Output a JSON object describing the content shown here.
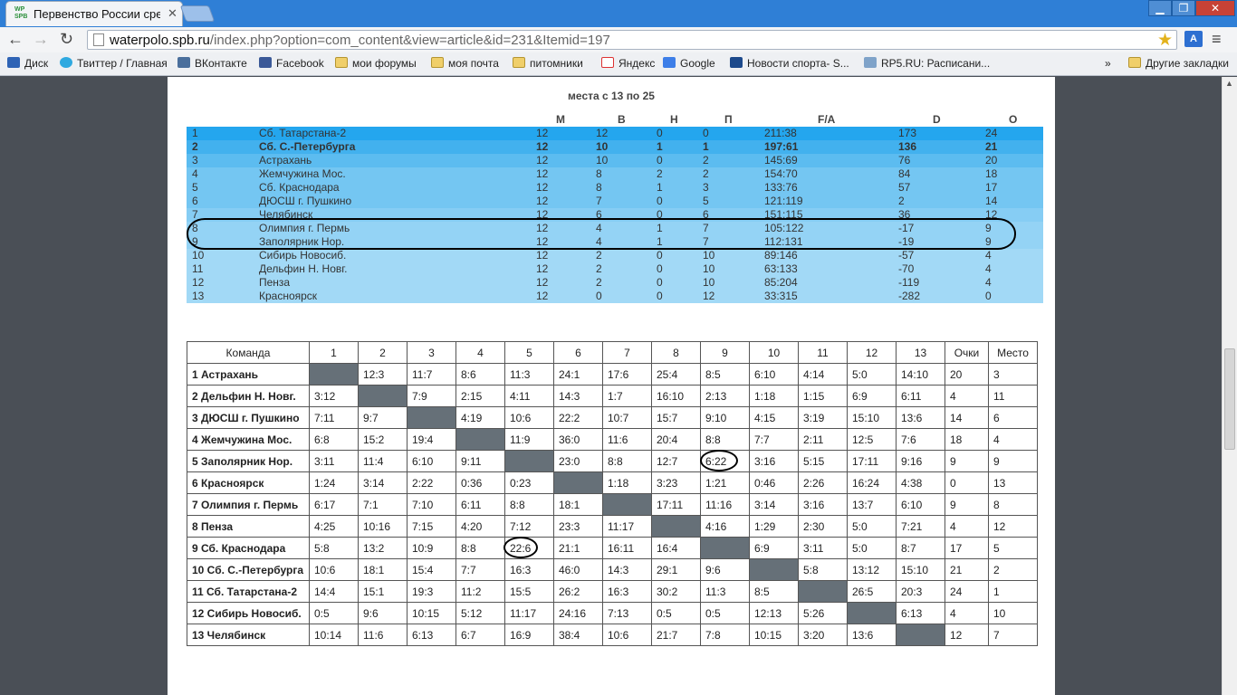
{
  "browser": {
    "tab_title": "Первенство России сред",
    "tab_favicon_text": "WP SPB",
    "url_domain": "waterpolo.spb.ru",
    "url_path": "/index.php?option=com_content&view=article&id=231&Itemid=197",
    "ext_label": "A",
    "bookmarks": [
      {
        "label": "Диск",
        "icon": "disk-icon"
      },
      {
        "label": "Твиттер / Главная",
        "icon": "twitter-icon"
      },
      {
        "label": "ВКонтакте",
        "icon": "vk-icon"
      },
      {
        "label": "Facebook",
        "icon": "facebook-icon"
      },
      {
        "label": "мои форумы",
        "icon": "folder-icon"
      },
      {
        "label": "моя почта",
        "icon": "folder-icon"
      },
      {
        "label": "питомники",
        "icon": "folder-icon"
      },
      {
        "label": "Яндекс",
        "icon": "yandex-icon"
      },
      {
        "label": "Google",
        "icon": "google-icon"
      },
      {
        "label": "Новости спорта- S...",
        "icon": "sport-news-icon"
      },
      {
        "label": "RP5.RU: Расписани...",
        "icon": "rp5-icon"
      }
    ],
    "bookmarks_overflow": "»",
    "other_bookmarks": "Другие закладки"
  },
  "standings_1": {
    "title": "места с 13 по 25",
    "headers": [
      "М",
      "В",
      "Н",
      "П",
      "F/A",
      "D",
      "О"
    ],
    "rows": [
      [
        "1",
        "Сб. Татарстана-2",
        "12",
        "12",
        "0",
        "0",
        "211:38",
        "173",
        "24"
      ],
      [
        "2",
        "Сб. С.-Петербурга",
        "12",
        "10",
        "1",
        "1",
        "197:61",
        "136",
        "21"
      ],
      [
        "3",
        "Астрахань",
        "12",
        "10",
        "0",
        "2",
        "145:69",
        "76",
        "20"
      ],
      [
        "4",
        "Жемчужина Мос.",
        "12",
        "8",
        "2",
        "2",
        "154:70",
        "84",
        "18"
      ],
      [
        "5",
        "Сб. Краснодара",
        "12",
        "8",
        "1",
        "3",
        "133:76",
        "57",
        "17"
      ],
      [
        "6",
        "ДЮСШ г. Пушкино",
        "12",
        "7",
        "0",
        "5",
        "121:119",
        "2",
        "14"
      ],
      [
        "7",
        "Челябинск",
        "12",
        "6",
        "0",
        "6",
        "151:115",
        "36",
        "12"
      ],
      [
        "8",
        "Олимпия г. Пермь",
        "12",
        "4",
        "1",
        "7",
        "105:122",
        "-17",
        "9"
      ],
      [
        "9",
        "Заполярник Нор.",
        "12",
        "4",
        "1",
        "7",
        "112:131",
        "-19",
        "9"
      ],
      [
        "10",
        "Сибирь Новосиб.",
        "12",
        "2",
        "0",
        "10",
        "89:146",
        "-57",
        "4"
      ],
      [
        "11",
        "Дельфин Н. Новг.",
        "12",
        "2",
        "0",
        "10",
        "63:133",
        "-70",
        "4"
      ],
      [
        "12",
        "Пенза",
        "12",
        "2",
        "0",
        "10",
        "85:204",
        "-119",
        "4"
      ],
      [
        "13",
        "Красноярск",
        "12",
        "0",
        "0",
        "12",
        "33:315",
        "-282",
        "0"
      ]
    ],
    "row_colors": [
      "#24a6ee",
      "#42b1ee",
      "#5cbcf0",
      "#74c6f2",
      "#74c6f2",
      "#74c6f2",
      "#86cdf4",
      "#94d3f5",
      "#94d3f5",
      "#a2d9f6",
      "#a2d9f6",
      "#a2d9f6",
      "#a2d9f6"
    ]
  },
  "crosstable": {
    "headers": [
      "Команда",
      "1",
      "2",
      "3",
      "4",
      "5",
      "6",
      "7",
      "8",
      "9",
      "10",
      "11",
      "12",
      "13",
      "Очки",
      "Место"
    ],
    "rows": [
      [
        "1 Астрахань",
        "",
        "12:3",
        "11:7",
        "8:6",
        "11:3",
        "24:1",
        "17:6",
        "25:4",
        "8:5",
        "6:10",
        "4:14",
        "5:0",
        "14:10",
        "20",
        "3"
      ],
      [
        "2 Дельфин Н. Новг.",
        "3:12",
        "",
        "7:9",
        "2:15",
        "4:11",
        "14:3",
        "1:7",
        "16:10",
        "2:13",
        "1:18",
        "1:15",
        "6:9",
        "6:11",
        "4",
        "11"
      ],
      [
        "3 ДЮСШ г. Пушкино",
        "7:11",
        "9:7",
        "",
        "4:19",
        "10:6",
        "22:2",
        "10:7",
        "15:7",
        "9:10",
        "4:15",
        "3:19",
        "15:10",
        "13:6",
        "14",
        "6"
      ],
      [
        "4 Жемчужина Мос.",
        "6:8",
        "15:2",
        "19:4",
        "",
        "11:9",
        "36:0",
        "11:6",
        "20:4",
        "8:8",
        "7:7",
        "2:11",
        "12:5",
        "7:6",
        "18",
        "4"
      ],
      [
        "5 Заполярник Нор.",
        "3:11",
        "11:4",
        "6:10",
        "9:11",
        "",
        "23:0",
        "8:8",
        "12:7",
        "6:22",
        "3:16",
        "5:15",
        "17:11",
        "9:16",
        "9",
        "9"
      ],
      [
        "6 Красноярск",
        "1:24",
        "3:14",
        "2:22",
        "0:36",
        "0:23",
        "",
        "1:18",
        "3:23",
        "1:21",
        "0:46",
        "2:26",
        "16:24",
        "4:38",
        "0",
        "13"
      ],
      [
        "7 Олимпия г. Пермь",
        "6:17",
        "7:1",
        "7:10",
        "6:11",
        "8:8",
        "18:1",
        "",
        "17:11",
        "11:16",
        "3:14",
        "3:16",
        "13:7",
        "6:10",
        "9",
        "8"
      ],
      [
        "8 Пенза",
        "4:25",
        "10:16",
        "7:15",
        "4:20",
        "7:12",
        "23:3",
        "11:17",
        "",
        "4:16",
        "1:29",
        "2:30",
        "5:0",
        "7:21",
        "4",
        "12"
      ],
      [
        "9 Сб. Краснодара",
        "5:8",
        "13:2",
        "10:9",
        "8:8",
        "22:6",
        "21:1",
        "16:11",
        "16:4",
        "",
        "6:9",
        "3:11",
        "5:0",
        "8:7",
        "17",
        "5"
      ],
      [
        "10 Сб. С.-Петербурга",
        "10:6",
        "18:1",
        "15:4",
        "7:7",
        "16:3",
        "46:0",
        "14:3",
        "29:1",
        "9:6",
        "",
        "5:8",
        "13:12",
        "15:10",
        "21",
        "2"
      ],
      [
        "11 Сб. Татарстана-2",
        "14:4",
        "15:1",
        "19:3",
        "11:2",
        "15:5",
        "26:2",
        "16:3",
        "30:2",
        "11:3",
        "8:5",
        "",
        "26:5",
        "20:3",
        "24",
        "1"
      ],
      [
        "12 Сибирь Новосиб.",
        "0:5",
        "9:6",
        "10:15",
        "5:12",
        "11:17",
        "24:16",
        "7:13",
        "0:5",
        "0:5",
        "12:13",
        "5:26",
        "",
        "6:13",
        "4",
        "10"
      ],
      [
        "13 Челябинск",
        "10:14",
        "11:6",
        "6:13",
        "6:7",
        "16:9",
        "38:4",
        "10:6",
        "21:7",
        "7:8",
        "10:15",
        "3:20",
        "13:6",
        "",
        "12",
        "7"
      ]
    ]
  }
}
